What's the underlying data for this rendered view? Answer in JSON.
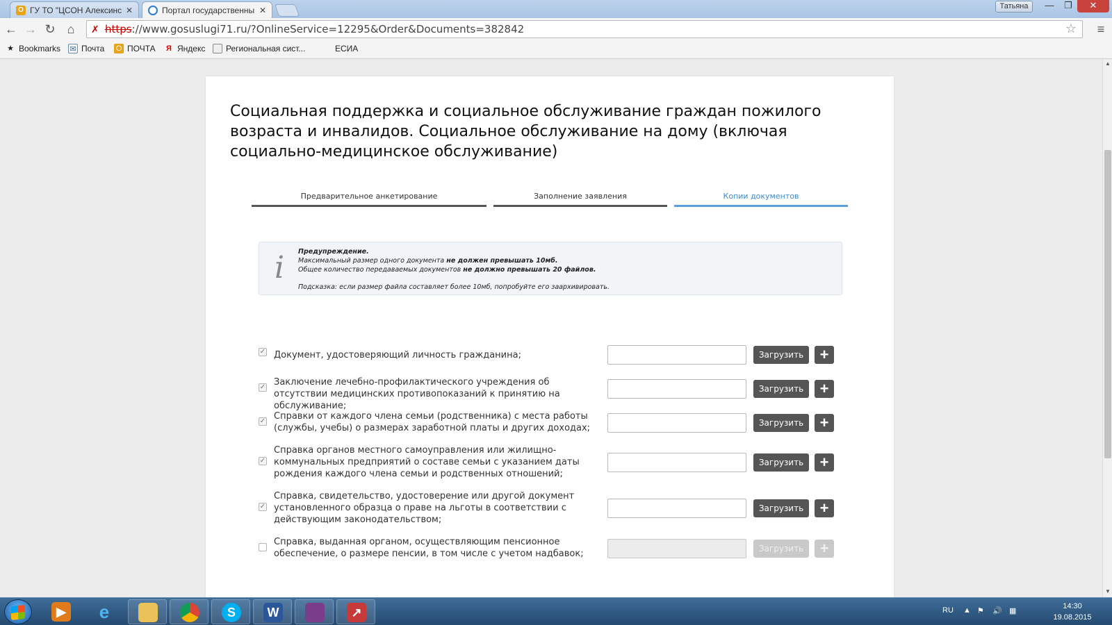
{
  "browser": {
    "tabs": [
      {
        "label": "ГУ ТО \"ЦСОН Алексинск",
        "active": false
      },
      {
        "label": "Портал государственны",
        "active": true
      }
    ],
    "user": "Татьяна",
    "url_protocol": "https",
    "url_rest": "://www.gosuslugi71.ru/?OnlineService=12295&Order&Documents=382842",
    "bookmarks": [
      "Bookmarks",
      "Почта",
      "ПОЧТА",
      "Яндекс",
      "Региональная сист...",
      "ЕСИА"
    ]
  },
  "page": {
    "title": "Социальная поддержка и социальное обслуживание граждан пожилого возраста и инвалидов. Социальное обслуживание на дому (включая социально-медицинское обслуживание)",
    "steps": [
      "Предварительное анкетирование",
      "Заполнение заявления",
      "Копии документов"
    ],
    "active_step": 2,
    "notice": {
      "heading": "Предупреждение.",
      "line1_a": "Максимальный размер одного документа ",
      "line1_b": "не должен превышать 10мб.",
      "line2_a": "Общее количество передаваемых документов ",
      "line2_b": "не должно превышать 20 файлов.",
      "hint": "Подсказка: если размер файла составляет более 10мб, попробуйте его заархивировать."
    },
    "upload_label": "Загрузить",
    "documents": [
      {
        "label": "Документ, удостоверяющий личность гражданина;",
        "checked": true,
        "enabled": true
      },
      {
        "label": "Заключение лечебно-профилактического учреждения об отсутствии медицинских противопоказаний к принятию на обслуживание;",
        "checked": true,
        "enabled": true
      },
      {
        "label": "Справки от каждого члена семьи (родственника) с места работы (службы, учебы) о размерах заработной платы и других доходах;",
        "checked": true,
        "enabled": true
      },
      {
        "label": "Справка органов местного самоуправления или жилищно-коммунальных предприятий о составе семьи с указанием даты рождения каждого члена семьи и родственных отношений;",
        "checked": true,
        "enabled": true
      },
      {
        "label": "Справка, свидетельство, удостоверение или другой документ установленного образца о праве на льготы в соответствии с действующим законодательством;",
        "checked": true,
        "enabled": true
      },
      {
        "label": "Справка, выданная органом, осуществляющим пенсионное обеспечение, о размере пенсии, в том числе с учетом надбавок;",
        "checked": false,
        "enabled": false
      }
    ]
  },
  "taskbar": {
    "lang": "RU",
    "time": "14:30",
    "date": "19.08.2015"
  }
}
